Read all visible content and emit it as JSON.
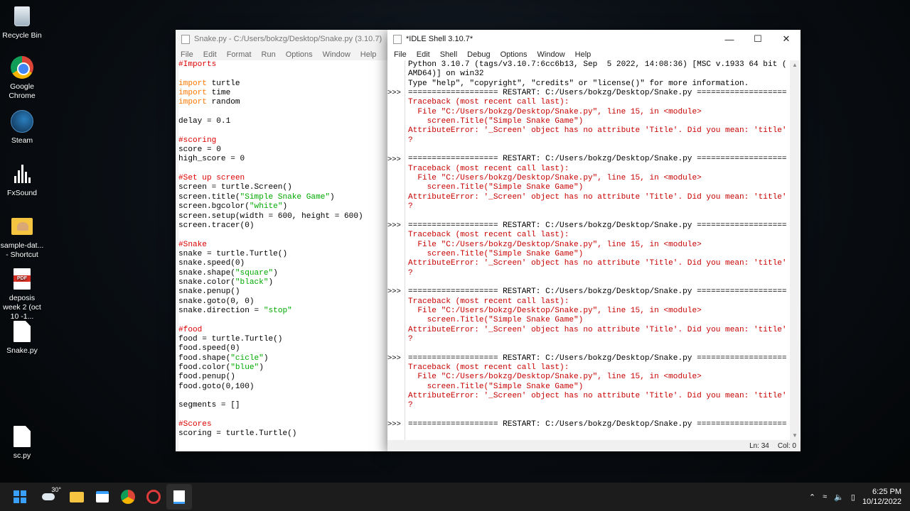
{
  "desktop": {
    "icons": [
      {
        "label": "Recycle Bin"
      },
      {
        "label": "Google Chrome"
      },
      {
        "label": "Steam"
      },
      {
        "label": "FxSound"
      },
      {
        "label": "sample-dat... - Shortcut"
      },
      {
        "label": "deposis week 2 (oct 10 -1..."
      },
      {
        "label": "Snake.py"
      },
      {
        "label": "sc.py"
      }
    ]
  },
  "editor": {
    "title": "Snake.py - C:/Users/bokzg/Desktop/Snake.py (3.10.7)",
    "menu": [
      "File",
      "Edit",
      "Format",
      "Run",
      "Options",
      "Window",
      "Help"
    ]
  },
  "shell": {
    "title": "*IDLE Shell 3.10.7*",
    "menu": [
      "File",
      "Edit",
      "Shell",
      "Debug",
      "Options",
      "Window",
      "Help"
    ],
    "banner": [
      "Python 3.10.7 (tags/v3.10.7:6cc6b13, Sep  5 2022, 14:08:36) [MSC v.1933 64 bit (",
      "AMD64)] on win32",
      "Type \"help\", \"copyright\", \"credits\" or \"license()\" for more information."
    ],
    "prompt": ">>>",
    "restart": "=================== RESTART: C:/Users/bokzg/Desktop/Snake.py ===================",
    "traceback": [
      "Traceback (most recent call last):",
      "  File \"C:/Users/bokzg/Desktop/Snake.py\", line 15, in <module>",
      "    screen.Title(\"Simple Snake Game\")",
      "AttributeError: '_Screen' object has no attribute 'Title'. Did you mean: 'title'",
      "?"
    ],
    "status_line": "Ln: 34",
    "status_col": "Col: 0"
  },
  "taskbar": {
    "weather": "30°",
    "time": "6:25 PM",
    "date": "10/12/2022"
  }
}
